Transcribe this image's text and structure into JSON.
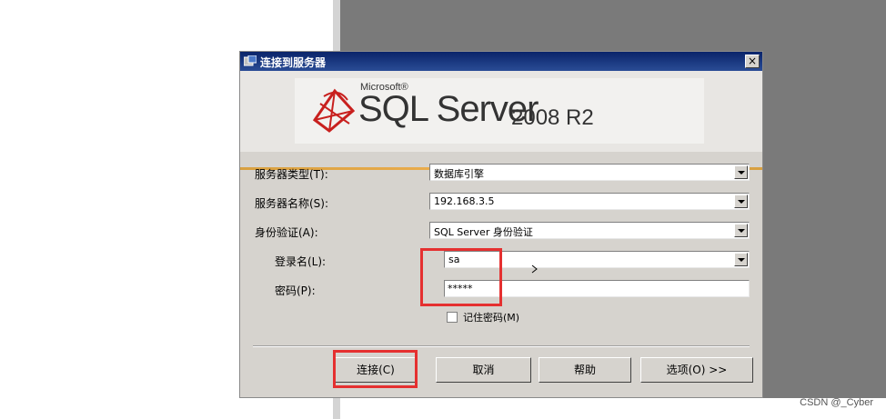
{
  "window": {
    "title": "连接到服务器",
    "close_label": "×"
  },
  "banner": {
    "brand": "Microsoft®",
    "product": "SQL Server",
    "version": "2008 R2"
  },
  "form": {
    "server_type": {
      "label": "服务器类型(T):",
      "value": "数据库引擎"
    },
    "server_name": {
      "label": "服务器名称(S):",
      "value": "192.168.3.5"
    },
    "auth": {
      "label": "身份验证(A):",
      "value": "SQL Server 身份验证"
    },
    "login": {
      "label": "登录名(L):",
      "value": "sa"
    },
    "password": {
      "label": "密码(P):",
      "value": "*****"
    },
    "remember": {
      "label": "记住密码(M)",
      "checked": false
    }
  },
  "buttons": {
    "connect": "连接(C)",
    "cancel": "取消",
    "help": "帮助",
    "options": "选项(O) >>"
  },
  "watermark": "CSDN @_Cyber",
  "colors": {
    "titlebar": "#0a246a",
    "highlight": "#e53030",
    "dialog_bg": "#d6d3ce"
  }
}
